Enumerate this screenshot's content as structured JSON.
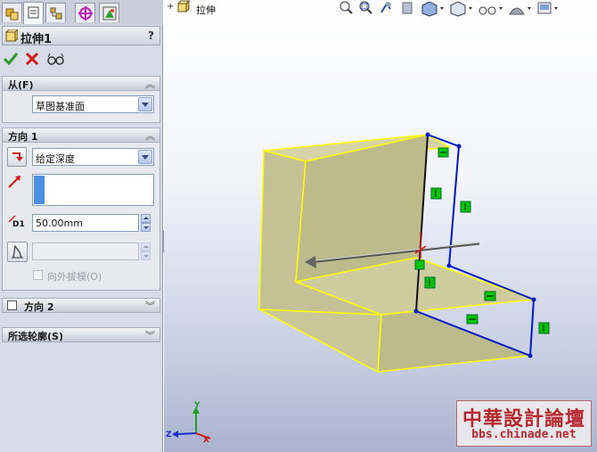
{
  "feature": {
    "title": "拉伸1",
    "help": "?"
  },
  "sections": {
    "from": {
      "label": "从(F)",
      "start_condition": "草图基准面"
    },
    "direction1": {
      "label": "方向 1",
      "end_condition": "给定深度",
      "depth_label": "D1",
      "depth_value": "50.00mm",
      "draft_outward_label": "向外拔模(O)"
    },
    "direction2": {
      "label": "方向 2"
    },
    "selected_contours": {
      "label": "所选轮廓(S)"
    }
  },
  "viewport": {
    "tree_label": "拉伸",
    "triad": {
      "x": "X",
      "y": "Y",
      "z": "Z"
    }
  },
  "watermark": {
    "title": "中華設計論壇",
    "url": "bbs.chinade.net"
  },
  "colors": {
    "model_face": "#c9c79c",
    "edge_highlight": "#ffff00",
    "sketch_line": "#0000cc",
    "relation_tag": "#00c800"
  },
  "icons": [
    "feature-manager-icon",
    "property-manager-icon",
    "configuration-manager-icon",
    "dimxpert-icon",
    "display-manager-icon",
    "ok-icon",
    "cancel-icon",
    "preview-icon",
    "zoom-to-fit-icon",
    "zoom-area-icon",
    "previous-view-icon",
    "section-view-icon",
    "view-orientation-icon",
    "display-style-icon",
    "hide-show-icon",
    "appearance-icon",
    "scene-icon"
  ]
}
